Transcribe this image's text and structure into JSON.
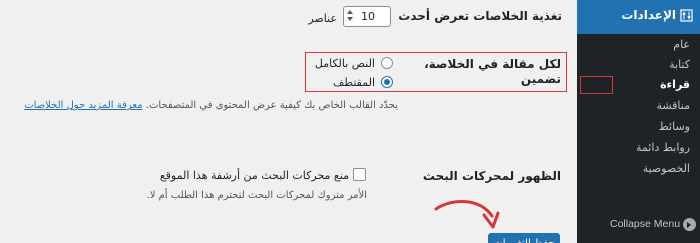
{
  "sidebar": {
    "header_label": "الإعدادات",
    "items": [
      {
        "label": "عام"
      },
      {
        "label": "كتابة"
      },
      {
        "label": "قراءة",
        "active": true
      },
      {
        "label": "مناقشة"
      },
      {
        "label": "وسائط"
      },
      {
        "label": "روابط دائمة"
      },
      {
        "label": "الخصوصية"
      }
    ],
    "collapse_label": "Collapse Menu"
  },
  "settings": {
    "feed_items": {
      "label": "تغذية الخلاصات تعرض أحدث",
      "value": "10",
      "unit": "عناصر"
    },
    "feed_content": {
      "label_line1": "لكل مقالة في الخلاصة،",
      "label_line2": "تضمين",
      "options": [
        {
          "label": "النص بالكامل",
          "checked": false
        },
        {
          "label": "المقتطف",
          "checked": true
        }
      ],
      "description": "يحدّد القالب الخاص بك كيفية عرض المحتوى في المتصفحات.",
      "link_text": "معرفة المزيد حول الخلاصات"
    },
    "search_visibility": {
      "label": "الظهور لمحركات البحث",
      "checkbox_label": "منع محركات البحث من أرشفة هذا الموقع",
      "checked": false,
      "description": "الأمر متروك لمحركات البحث لتحترم هذا الطلب أم لا."
    }
  },
  "actions": {
    "save_label": "حفظ التغييرات"
  },
  "colors": {
    "accent": "#2271b1",
    "sidebar_bg": "#1d2327",
    "highlight": "#d63638"
  }
}
